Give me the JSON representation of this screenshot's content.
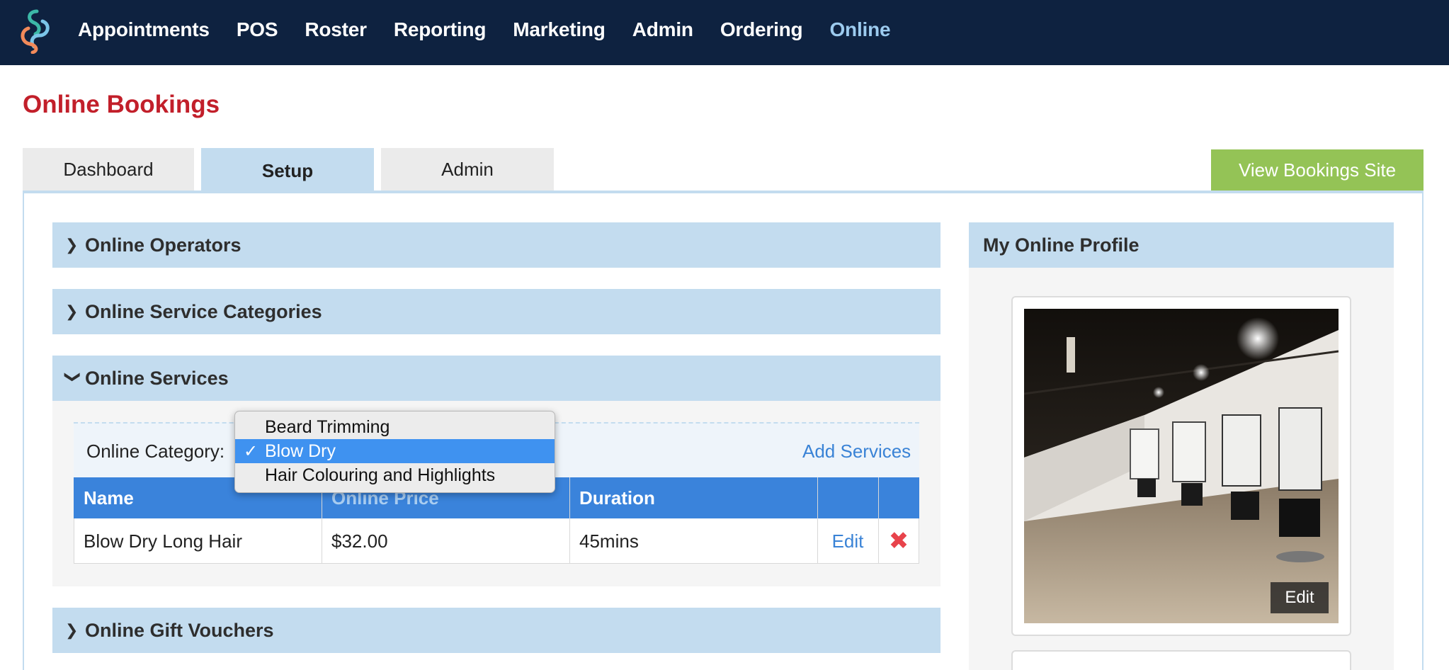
{
  "nav": {
    "items": [
      {
        "label": "Appointments"
      },
      {
        "label": "POS"
      },
      {
        "label": "Roster"
      },
      {
        "label": "Reporting"
      },
      {
        "label": "Marketing"
      },
      {
        "label": "Admin"
      },
      {
        "label": "Ordering"
      },
      {
        "label": "Online",
        "active": true
      }
    ]
  },
  "page": {
    "title": "Online Bookings"
  },
  "tabs": [
    {
      "label": "Dashboard"
    },
    {
      "label": "Setup",
      "active": true
    },
    {
      "label": "Admin"
    }
  ],
  "view_site_label": "View Bookings Site",
  "sections": {
    "operators": "Online Operators",
    "categories": "Online Service Categories",
    "services": "Online Services",
    "vouchers": "Online Gift Vouchers"
  },
  "services": {
    "category_label": "Online Category:",
    "add_label": "Add Services",
    "dropdown": {
      "options": [
        "Beard Trimming",
        "Blow Dry",
        "Hair Colouring and Highlights"
      ],
      "selected": "Blow Dry",
      "check": "✓"
    },
    "table": {
      "headers": [
        "Name",
        "Online Price",
        "Duration"
      ],
      "rows": [
        {
          "name": "Blow Dry Long Hair",
          "price": "$32.00",
          "duration": "45mins",
          "edit": "Edit",
          "delete": "✖"
        }
      ]
    }
  },
  "profile": {
    "title": "My Online Profile",
    "photo_edit": "Edit"
  },
  "colors": {
    "nav_bg": "#0e2240",
    "title_red": "#c21f2a",
    "section_blue": "#c3dcef",
    "table_header": "#3a83db",
    "green_button": "#94c356",
    "link_blue": "#3a83d6"
  }
}
